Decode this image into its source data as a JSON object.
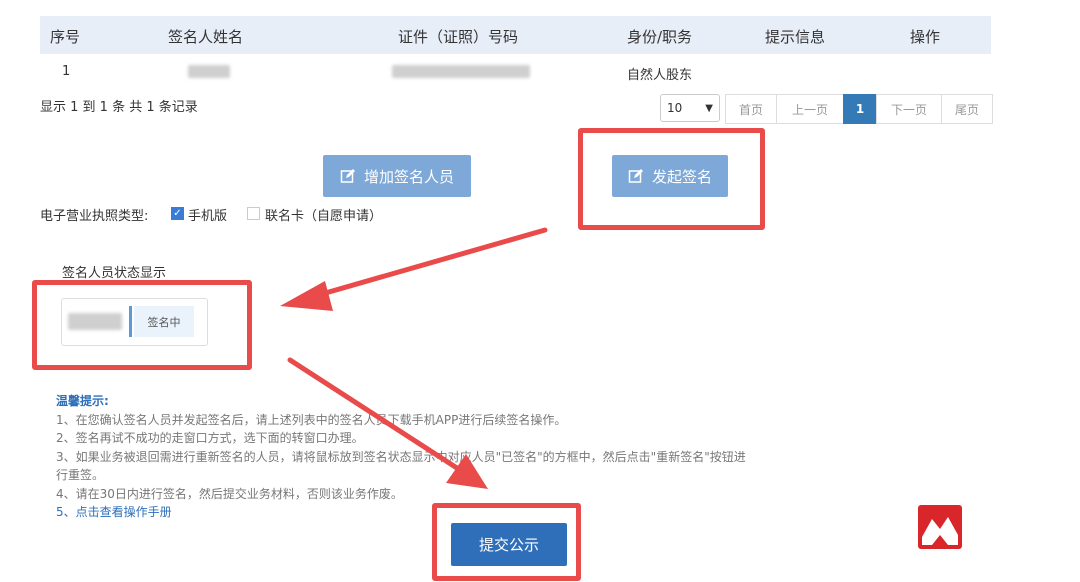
{
  "table": {
    "headers": [
      "序号",
      "签名人姓名",
      "证件（证照）号码",
      "身份/职务",
      "提示信息",
      "操作"
    ],
    "row": {
      "index": "1",
      "role": "自然人股东"
    }
  },
  "records": "显示 1 到 1 条 共 1 条记录",
  "pager": {
    "page_size": "10",
    "first": "首页",
    "prev": "上一页",
    "current": "1",
    "next": "下一页",
    "last": "尾页"
  },
  "buttons": {
    "add_signer": "增加签名人员",
    "start_sign": "发起签名",
    "submit": "提交公示"
  },
  "license": {
    "label": "电子营业执照类型:",
    "mobile": "手机版",
    "mobile_checked": true,
    "combo_card": "联名卡（自愿申请）",
    "combo_checked": false
  },
  "signer_status": {
    "title": "签名人员状态显示",
    "status": "签名中"
  },
  "tips": {
    "title": "温馨提示:",
    "line1": "1、在您确认签名人员并发起签名后，请上述列表中的签名人员下载手机APP进行后续签名操作。",
    "line2": "2、签名再试不成功的走窗口方式，选下面的转窗口办理。",
    "line3a": "3、如果业务被退回需进行重新签名的人员，请将鼠标放到签名状态显示中对应人员\"已签名\"的方框中，然后点击\"重新签名\"按钮进",
    "line3b": "行重签。",
    "line4": "4、请在30日内进行签名，然后提交业务材料，否则该业务作废。",
    "line5": "5、点击查看操作手册"
  },
  "colors": {
    "accent": "#2f6fba",
    "light_button": "#7ea8d7",
    "annotation_red": "#e94a4a",
    "header_bg": "#e8eef8"
  },
  "icons": {
    "edit": "edit-icon",
    "check": "checkmark-icon",
    "chevron": "chevron-down-icon",
    "logo": "mountain-logo"
  }
}
